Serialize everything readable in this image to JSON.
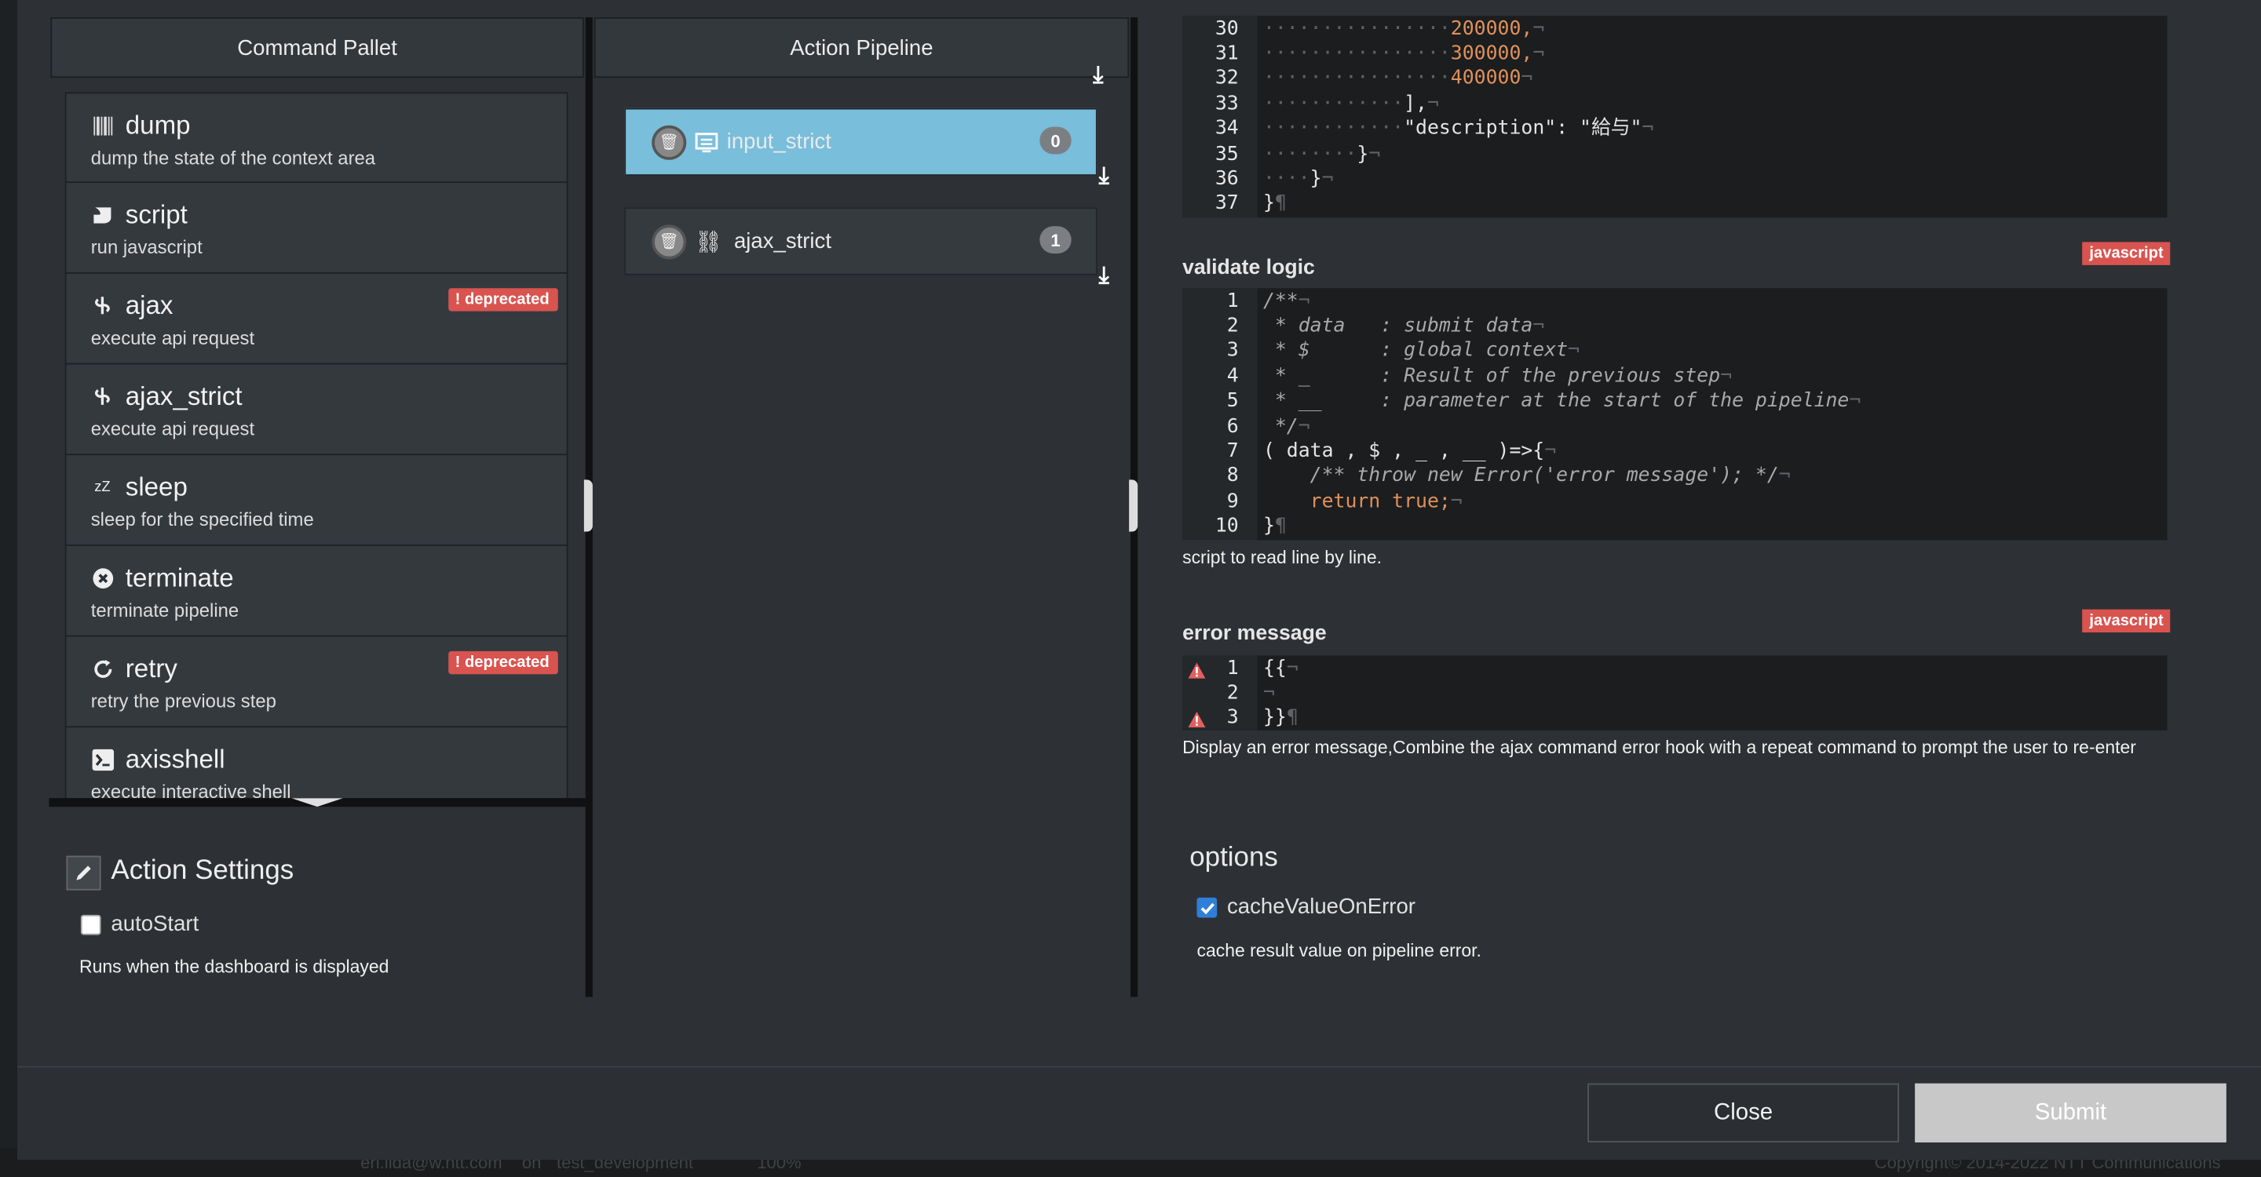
{
  "left": {
    "title": "Command Pallet",
    "commands": [
      {
        "name": "dump",
        "desc": "dump the state of the context area",
        "icon": "barcode-icon",
        "deprecated": false
      },
      {
        "name": "script",
        "desc": "run javascript",
        "icon": "script-icon",
        "deprecated": false
      },
      {
        "name": "ajax",
        "desc": "execute api request",
        "icon": "link-icon",
        "deprecated": true
      },
      {
        "name": "ajax_strict",
        "desc": "execute api request",
        "icon": "link-icon",
        "deprecated": false
      },
      {
        "name": "sleep",
        "desc": "sleep for the specified time",
        "icon": "sleep-icon",
        "deprecated": false
      },
      {
        "name": "terminate",
        "desc": "terminate pipeline",
        "icon": "close-circle-icon",
        "deprecated": false
      },
      {
        "name": "retry",
        "desc": "retry the previous step",
        "icon": "refresh-icon",
        "deprecated": true
      },
      {
        "name": "axisshell",
        "desc": "execute interactive shell",
        "icon": "terminal-icon",
        "deprecated": false
      }
    ],
    "deprecated_label": "deprecated"
  },
  "settings": {
    "title": "Action Settings",
    "autostart_label": "autoStart",
    "autostart_checked": false,
    "autostart_help": "Runs when the dashboard is displayed"
  },
  "pipeline": {
    "title": "Action Pipeline",
    "items": [
      {
        "name": "input_strict",
        "index": "0",
        "active": true,
        "icon": "keyboard-icon"
      },
      {
        "name": "ajax_strict",
        "index": "1",
        "active": false,
        "icon": "link-icon"
      }
    ]
  },
  "right": {
    "top_code": [
      {
        "n": "30",
        "indent": 16,
        "text": "200000,"
      },
      {
        "n": "31",
        "indent": 16,
        "text": "300000,"
      },
      {
        "n": "32",
        "indent": 16,
        "text": "400000"
      },
      {
        "n": "33",
        "indent": 12,
        "text": "],"
      },
      {
        "n": "34",
        "indent": 12,
        "text": "\"description\": \"給与\""
      },
      {
        "n": "35",
        "indent": 8,
        "text": "}"
      },
      {
        "n": "36",
        "indent": 4,
        "text": "}"
      },
      {
        "n": "37",
        "indent": 0,
        "text": "}"
      }
    ],
    "validate": {
      "label": "validate logic",
      "badge": "javascript",
      "help": "script to read line by line.",
      "lines": [
        {
          "n": "1",
          "text": "/**"
        },
        {
          "n": "2",
          "text": " * data   : submit data"
        },
        {
          "n": "3",
          "text": " * $      : global context"
        },
        {
          "n": "4",
          "text": " * _      : Result of the previous step"
        },
        {
          "n": "5",
          "text": " * __     : parameter at the start of the pipeline"
        },
        {
          "n": "6",
          "text": " */"
        },
        {
          "n": "7",
          "text": "( data , $ , _ , __ )=>{"
        },
        {
          "n": "8",
          "text": "    /** throw new Error('error message'); */"
        },
        {
          "n": "9",
          "text": "    return true;"
        },
        {
          "n": "10",
          "text": "}"
        }
      ]
    },
    "error": {
      "label": "error message",
      "badge": "javascript",
      "help": "Display an error message,Combine the ajax command error hook with a repeat command to prompt the user to re-enter",
      "lines": [
        {
          "n": "1",
          "text": "{{",
          "warn": true
        },
        {
          "n": "2",
          "text": "",
          "warn": false
        },
        {
          "n": "3",
          "text": "}}",
          "warn": true
        }
      ]
    },
    "options": {
      "title": "options",
      "cache_label": "cacheValueOnError",
      "cache_checked": true,
      "cache_help": "cache result value on pipeline error."
    }
  },
  "footer": {
    "close": "Close",
    "submit": "Submit"
  },
  "statusbar": {
    "user": "eri.iida@w.ntt.com",
    "on": "on",
    "project": "test_development",
    "zoom": "100%",
    "copyright": "Copyright© 2014-2022 NTT Communications"
  },
  "colors": {
    "active": "#79bedb",
    "badge": "#d9534f",
    "submit_bg": "#c8c8c8"
  }
}
